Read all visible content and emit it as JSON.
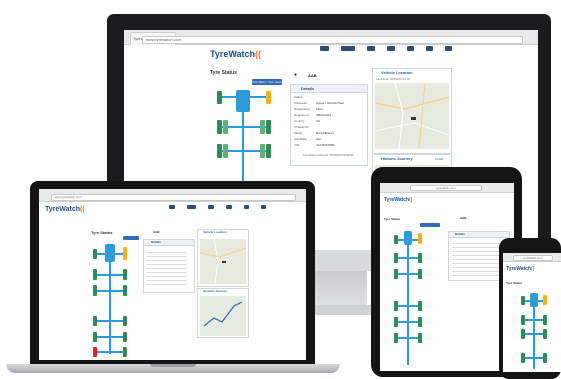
{
  "brand": {
    "name": "TyreWatch",
    "accent": "#1f4e8c",
    "orange": "#e8742a",
    "tyre_green": "#2f8a57",
    "axle_blue": "#2e9bd6",
    "warn_yellow": "#f1b41c",
    "alert_red": "#d92a2a"
  },
  "imac": {
    "url": "www.tyrewatch.com",
    "page_title": "Tyre Status",
    "tyre_button": "Tyre Warn / Tyre report",
    "vehicle_id": "AAB",
    "details": {
      "title": "Details",
      "rows": [
        {
          "k": "Status",
          "v": ""
        },
        {
          "k": "Odometer",
          "v": "Actual / Vehicle Fleet"
        },
        {
          "k": "Registration",
          "v": "Fleet"
        },
        {
          "k": "Registered",
          "v": "ABK0C0A1"
        },
        {
          "k": "Country",
          "v": "UK"
        },
        {
          "k": "Chassis ID",
          "v": ""
        },
        {
          "k": "Model",
          "v": "Bored/Bronze"
        },
        {
          "k": "Axle/Rear",
          "v": "4x2"
        },
        {
          "k": "VIN",
          "v": "01234567890"
        }
      ],
      "update": "Last data collected: 00/00/00 00:00:00"
    },
    "location": {
      "title": "Vehicle Location",
      "sub": "Last data: 00/00/00 00:00"
    },
    "journey": {
      "title": "Historic Journey",
      "link": "LOAD"
    }
  },
  "laptop": {
    "url": "www.tyrewatch.com",
    "page_title": "Tyre Status",
    "vehicle_id": "AAB",
    "details_title": "Details",
    "location_title": "Vehicle Location",
    "journey_title": "Historic Journey"
  },
  "tablet": {
    "url": "tyrewatch.com",
    "page_title": "Tyre Status",
    "vehicle_id": "AAB",
    "details_title": "Details"
  },
  "phone": {
    "url": "tyrewatch.com",
    "page_title": "Tyre Status"
  }
}
